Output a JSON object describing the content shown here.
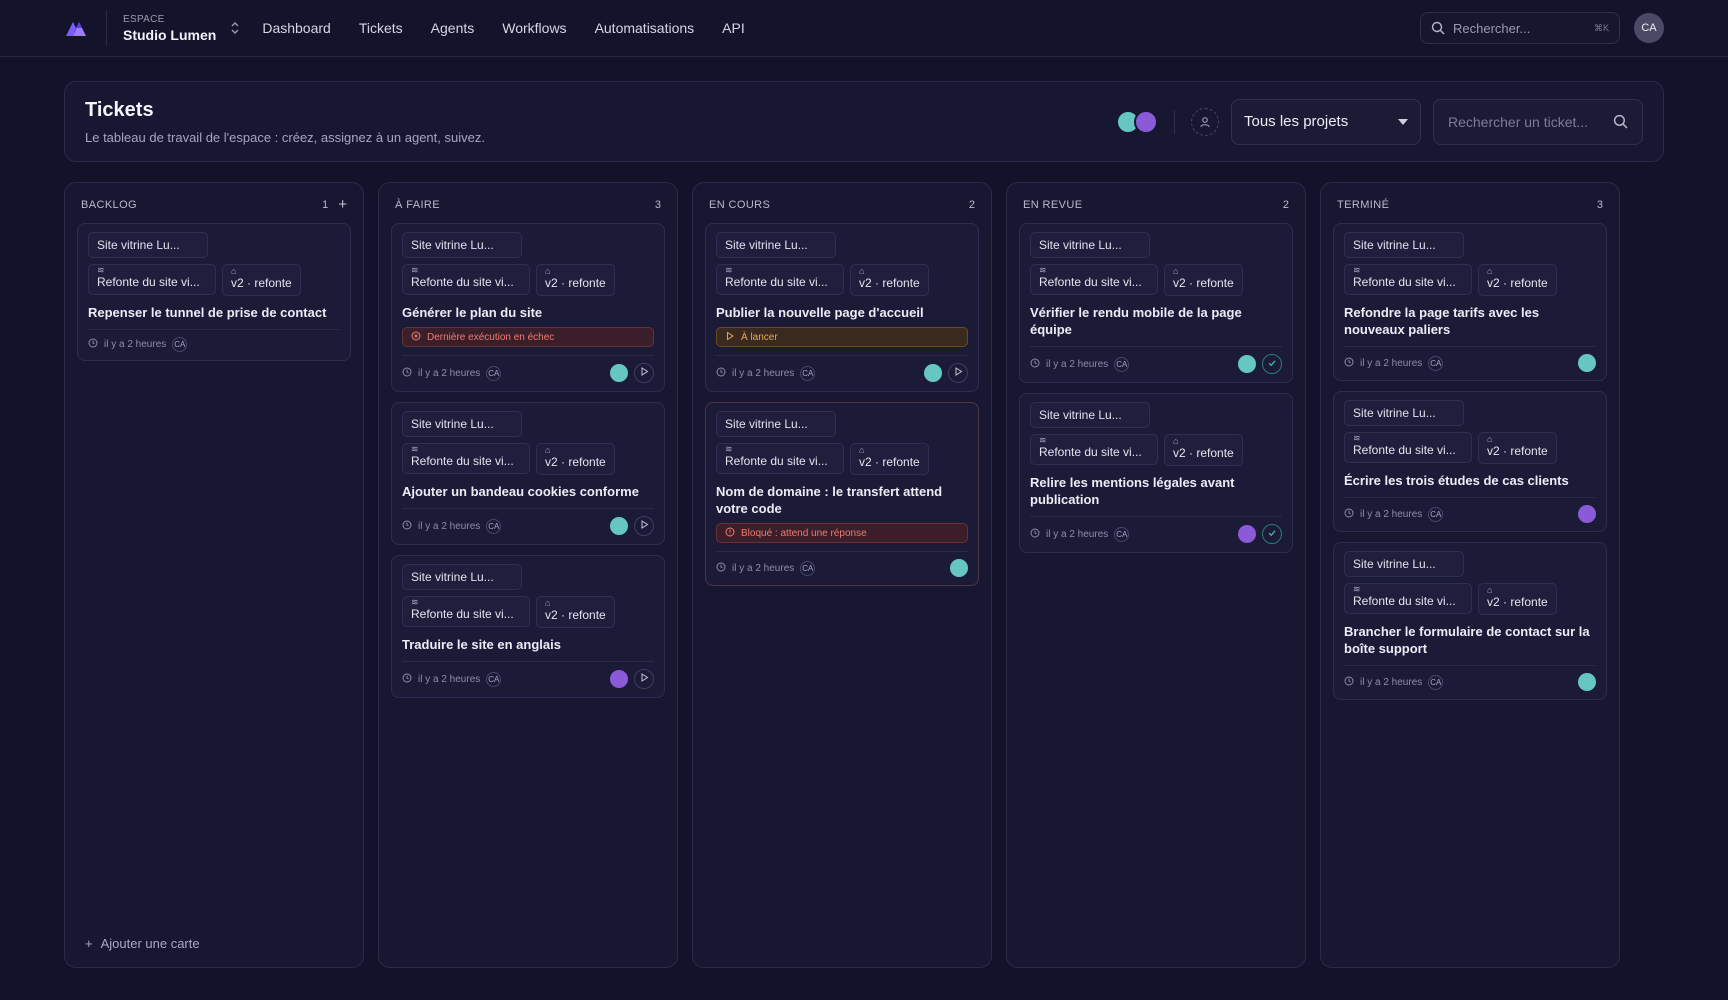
{
  "topnav": {
    "workspace_label": "ESPACE",
    "workspace_name": "Studio Lumen",
    "items": [
      "Dashboard",
      "Tickets",
      "Agents",
      "Workflows",
      "Automatisations",
      "API"
    ],
    "search_placeholder": "Rechercher...",
    "search_shortcut": "⌘K",
    "user_initials": "CA"
  },
  "header": {
    "title": "Tickets",
    "subtitle": "Le tableau de travail de l'espace : créez, assignez à un agent, suivez.",
    "project_select": "Tous les projets",
    "search_placeholder": "Rechercher un ticket..."
  },
  "common": {
    "project_chip": "Site vitrine Lu...",
    "epic_chip": "Refonte du site vi...",
    "tag_chip": "v2 · refonte",
    "time": "il y a 2 heures",
    "initials": "CA"
  },
  "columns": [
    {
      "title": "BACKLOG",
      "count": "1",
      "add": "+",
      "add_card": "Ajouter une carte",
      "cards": [
        {
          "title": "Repenser le tunnel de prise de contact"
        }
      ]
    },
    {
      "title": "À FAIRE",
      "count": "3",
      "cards": [
        {
          "title": "Générer le plan du site",
          "status": "Dernière exécution en échec"
        },
        {
          "title": "Ajouter un bandeau cookies conforme"
        },
        {
          "title": "Traduire le site en anglais"
        }
      ]
    },
    {
      "title": "EN COURS",
      "count": "2",
      "cards": [
        {
          "title": "Publier la nouvelle page d'accueil",
          "status": "À lancer"
        },
        {
          "title": "Nom de domaine : le transfert attend votre code",
          "status": "Bloqué : attend une réponse"
        }
      ]
    },
    {
      "title": "EN REVUE",
      "count": "2",
      "cards": [
        {
          "title": "Vérifier le rendu mobile de la page équipe"
        },
        {
          "title": "Relire les mentions légales avant publication"
        }
      ]
    },
    {
      "title": "TERMINÉ",
      "count": "3",
      "cards": [
        {
          "title": "Refondre la page tarifs avec les nouveaux paliers"
        },
        {
          "title": "Écrire les trois études de cas clients"
        },
        {
          "title": "Brancher le formulaire de contact sur la boîte support"
        }
      ]
    }
  ],
  "colors": {
    "background": "#12122a",
    "panel": "#171731",
    "accent": "#7c5cff",
    "error": "#ef7b70",
    "warning": "#e7a55c",
    "success": "#3fb8a8"
  }
}
